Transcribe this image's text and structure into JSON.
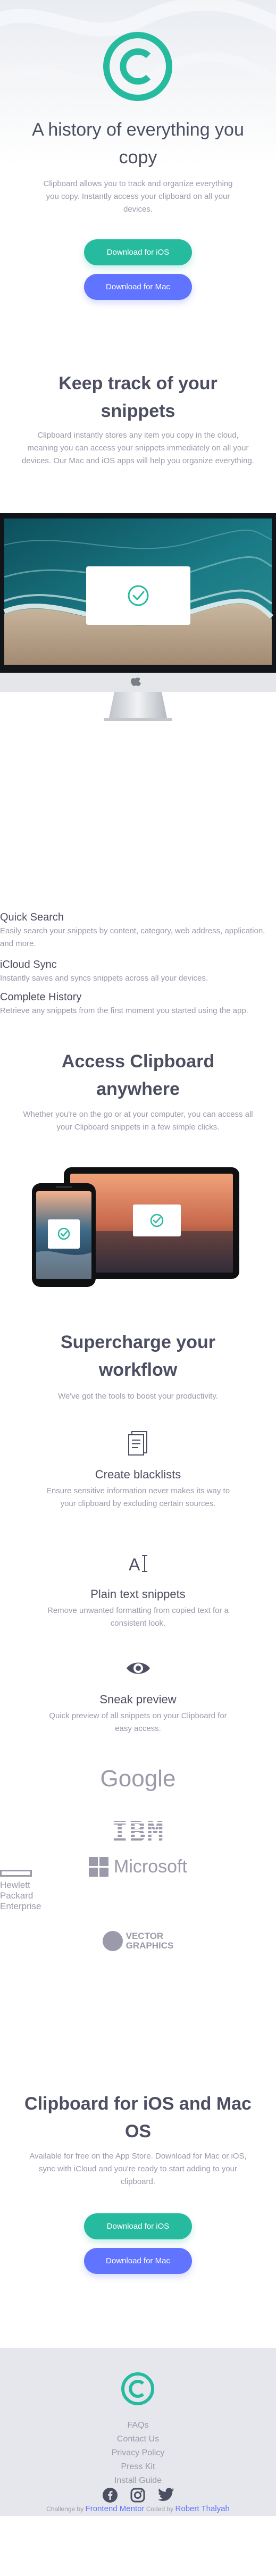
{
  "hero": {
    "title": "A history of everything you copy",
    "text": "Clipboard allows you to track and organize everything you copy. Instantly access your clipboard on all your devices.",
    "btn_ios": "Download for iOS",
    "btn_mac": "Download for Mac"
  },
  "track": {
    "title": "Keep track of your snippets",
    "text": "Clipboard instantly stores any item you copy in the cloud, meaning you can access your snippets immediately on all your devices. Our Mac and iOS apps will help you organize everything.",
    "features": [
      {
        "title": "Quick Search",
        "text": "Easily search your snippets by content, category, web address, application, and more."
      },
      {
        "title": "iCloud Sync",
        "text": "Instantly saves and syncs snippets across all your devices."
      },
      {
        "title": "Complete History",
        "text": "Retrieve any snippets from the first moment you started using the app."
      }
    ]
  },
  "access": {
    "title": "Access Clipboard anywhere",
    "text": "Whether you're on the go or at your computer, you can access all your Clipboard snippets in a few simple clicks."
  },
  "supercharge": {
    "title": "Supercharge your workflow",
    "text": "We've got the tools to boost your productivity.",
    "features": [
      {
        "icon": "blacklist-icon",
        "title": "Create blacklists",
        "text": "Ensure sensitive information never makes its way to your clipboard by excluding certain sources."
      },
      {
        "icon": "text-icon",
        "title": "Plain text snippets",
        "text": "Remove unwanted formatting from copied text for a consistent look."
      },
      {
        "icon": "eye-icon",
        "title": "Sneak preview",
        "text": "Quick preview of all snippets on your Clipboard for easy access."
      }
    ],
    "brands": {
      "google": "Google",
      "ibm": "IBM",
      "microsoft": "Microsoft",
      "hpe_line1": "Hewlett Packard",
      "hpe_line2": "Enterprise",
      "vg_line1": "VECTOR",
      "vg_line2": "GRAPHICS"
    }
  },
  "cta": {
    "title": "Clipboard for iOS and Mac OS",
    "text": "Available for free on the App Store. Download for Mac or iOS, sync with iCloud and you're ready to start adding to your clipboard.",
    "btn_ios": "Download for iOS",
    "btn_mac": "Download for Mac"
  },
  "footer": {
    "links": [
      "FAQs",
      "Contact Us",
      "Privacy Policy",
      "Press Kit",
      "Install Guide"
    ],
    "social_icons": [
      "facebook-icon",
      "instagram-icon",
      "twitter-icon"
    ],
    "credit_prefix": "Challenge by",
    "credit_author_prefix": "Coded by",
    "credit_org": "Frontend Mentor",
    "credit_author": "Robert Thalyah"
  },
  "colors": {
    "accent_green": "#26ba9f",
    "accent_blue": "#6174ff",
    "heading": "#4c4e61",
    "body": "#9a9aab",
    "footer_bg": "#e5e7ec"
  }
}
